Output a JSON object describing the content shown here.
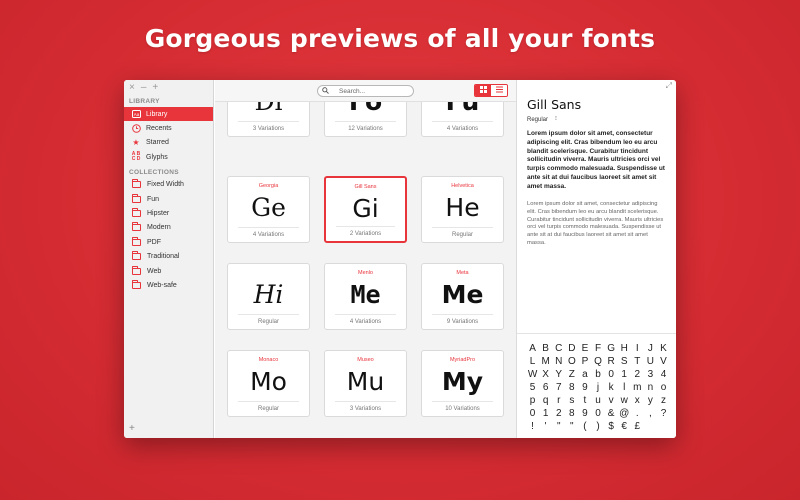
{
  "headline": "Gorgeous previews of all your fonts",
  "window_controls": [
    "×",
    "–",
    "+"
  ],
  "sidebar": {
    "library_header": "LIBRARY",
    "library_items": [
      {
        "label": "Library",
        "icon": "library-icon",
        "active": true
      },
      {
        "label": "Recents",
        "icon": "clock-icon",
        "active": false
      },
      {
        "label": "Starred",
        "icon": "star-icon",
        "active": false
      },
      {
        "label": "Glyphs",
        "icon": "glyphs-icon",
        "active": false
      }
    ],
    "collections_header": "COLLECTIONS",
    "collections": [
      "Fixed Width",
      "Fun",
      "Hipster",
      "Modern",
      "PDF",
      "Traditional",
      "Web",
      "Web-safe"
    ],
    "add_label": "+"
  },
  "toolbar": {
    "search_placeholder": "Search...",
    "grid_view_icon": "grid-view-icon",
    "list_view_icon": "list-view-icon"
  },
  "cards": [
    {
      "name": "",
      "glyph": "Di",
      "variations": "3 Variations",
      "font": "serif",
      "weight": "normal",
      "style": "normal"
    },
    {
      "name": "",
      "glyph": "Fo",
      "variations": "12 Variations",
      "font": "sans-serif",
      "weight": "bold",
      "style": "normal"
    },
    {
      "name": "",
      "glyph": "Fu",
      "variations": "4 Variations",
      "font": "sans-serif",
      "weight": "bold",
      "style": "normal"
    },
    {
      "name": "Georgia",
      "glyph": "Ge",
      "variations": "4 Variations",
      "font": "serif",
      "weight": "normal",
      "style": "normal"
    },
    {
      "name": "Gill Sans",
      "glyph": "Gi",
      "variations": "2 Variations",
      "font": "sans-serif",
      "weight": "normal",
      "style": "normal",
      "selected": true
    },
    {
      "name": "Helvetica",
      "glyph": "He",
      "variations": "Regular",
      "font": "sans-serif",
      "weight": "normal",
      "style": "normal"
    },
    {
      "name": "",
      "glyph": "Hi",
      "variations": "Regular",
      "font": "serif",
      "weight": "normal",
      "style": "italic"
    },
    {
      "name": "Menlo",
      "glyph": "Me",
      "variations": "4 Variations",
      "font": "monospace",
      "weight": "bold",
      "style": "normal"
    },
    {
      "name": "Meta",
      "glyph": "Me",
      "variations": "9 Variations",
      "font": "sans-serif",
      "weight": "bold",
      "style": "normal"
    },
    {
      "name": "Monaco",
      "glyph": "Mo",
      "variations": "Regular",
      "font": "sans-serif",
      "weight": "normal",
      "style": "normal"
    },
    {
      "name": "Museo",
      "glyph": "Mu",
      "variations": "3 Variations",
      "font": "sans-serif",
      "weight": "normal",
      "style": "normal"
    },
    {
      "name": "MyriadPro",
      "glyph": "My",
      "variations": "10 Variations",
      "font": "sans-serif",
      "weight": "bold",
      "style": "normal"
    }
  ],
  "detail": {
    "font_name": "Gill Sans",
    "style_label": "Regular",
    "style_arrow": "⌃⌄",
    "bold_paragraph": "Lorem ipsum dolor sit amet, consectetur adipiscing elit. Cras bibendum leo eu arcu blandit scelerisque. Curabitur tincidunt sollicitudin viverra. Mauris ultricies orci vel turpis commodo malesuada. Suspendisse ut ante sit at dui faucibus laoreet sit amet sit amet massa.",
    "light_paragraph": "Lorem ipsum dolor sit amet, consectetur adipiscing elit. Cras bibendum leo eu arcu blandit scelerisque. Curabitur tincidunt sollicitudin viverra. Mauris ultricies orci vel turpis commodo malesuada. Suspendisse ut ante sit at dui faucibus laoreet sit amet sit amet massa.",
    "glyphs": [
      "A",
      "B",
      "C",
      "D",
      "E",
      "F",
      "G",
      "H",
      "I",
      "J",
      "K",
      "L",
      "M",
      "N",
      "O",
      "P",
      "Q",
      "R",
      "S",
      "T",
      "U",
      "V",
      "W",
      "X",
      "Y",
      "Z",
      "a",
      "b",
      "0",
      "1",
      "2",
      "3",
      "4",
      "5",
      "6",
      "7",
      "8",
      "9",
      "j",
      "k",
      "l",
      "m",
      "n",
      "o",
      "p",
      "q",
      "r",
      "s",
      "t",
      "u",
      "v",
      "w",
      "x",
      "y",
      "z",
      "0",
      "1",
      "2",
      "8",
      "9",
      "0",
      "&",
      "@",
      ".",
      ",",
      "?",
      "!",
      "'",
      "\"",
      "\"",
      "(",
      ")",
      "$",
      "€",
      "£"
    ]
  },
  "colors": {
    "accent": "#e8343b",
    "background": "#d62c33"
  }
}
